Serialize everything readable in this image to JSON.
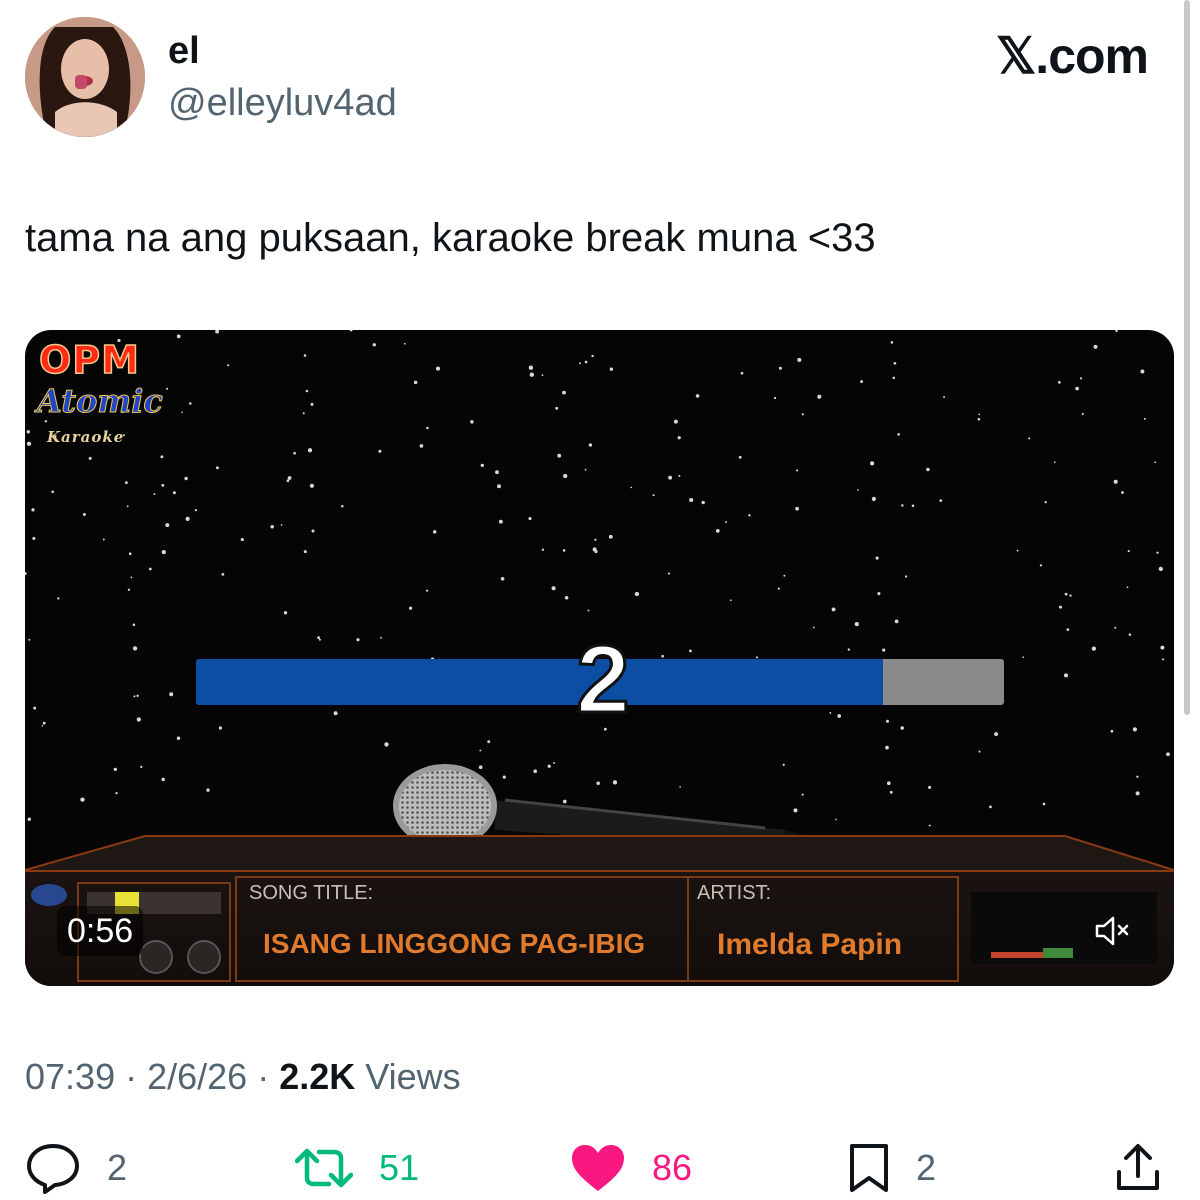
{
  "user": {
    "display_name": "el",
    "handle": "@elleyluv4ad"
  },
  "brand": "𝕏.com",
  "tweet": {
    "text": "tama na ang puksaan, karaoke break muna <33"
  },
  "video": {
    "logo": {
      "line1": "OPM",
      "line2": "Atomic",
      "line3": "Karaoke"
    },
    "countdown_number": "2",
    "countdown_progress": 0.85,
    "song_title_label": "SONG TITLE:",
    "song_title": "ISANG LINGGONG PAG-IBIG",
    "artist_label": "ARTIST:",
    "artist": "Imelda Papin",
    "time": "0:56",
    "muted": true,
    "colors": {
      "bar_fill": "#0b4ea3",
      "bar_track": "#8a8a8a",
      "panel_accent": "#e07a2c"
    }
  },
  "meta": {
    "time": "07:39",
    "sep1": " · ",
    "date": "2/6/26",
    "sep2": " · ",
    "views_count": "2.2K",
    "views_label": "Views"
  },
  "actions": {
    "reply_count": "2",
    "retweet_count": "51",
    "like_count": "86",
    "bookmark_count": "2",
    "colors": {
      "retweet": "#00ba7c",
      "like": "#f91880",
      "neutral": "#536471"
    }
  }
}
